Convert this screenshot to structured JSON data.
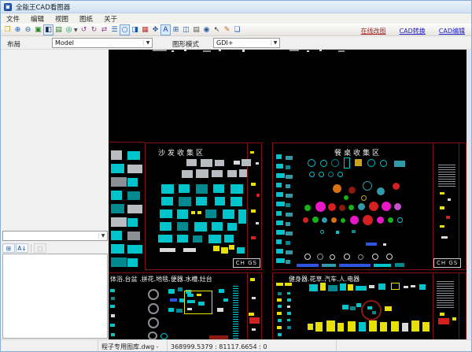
{
  "window": {
    "title": "全能王CAD看图器"
  },
  "menu": {
    "items": [
      {
        "label": "文件"
      },
      {
        "label": "编辑"
      },
      {
        "label": "视图"
      },
      {
        "label": "图纸"
      },
      {
        "label": "关于"
      }
    ]
  },
  "toolbar": {
    "icons": [
      {
        "name": "open-file-icon",
        "glyph": "❒",
        "color": "#caa31a"
      },
      {
        "name": "zoom-in-icon",
        "glyph": "⊕",
        "color": "#1a57a8"
      },
      {
        "name": "zoom-out-icon",
        "glyph": "⊖",
        "color": "#1a57a8"
      },
      {
        "name": "fit-view-icon",
        "glyph": "▣",
        "color": "#1f8a1f"
      },
      {
        "name": "background-toggle-icon",
        "glyph": "◧",
        "color": "#14264a",
        "pressed": true
      },
      {
        "name": "save-image-icon",
        "glyph": "▤",
        "color": "#1f8a1f"
      },
      {
        "name": "export-icon",
        "glyph": "◎",
        "color": "#1f8a6a",
        "dropdown": true
      },
      {
        "name": "rotate-left-icon",
        "glyph": "↺",
        "color": "#8a3c8a"
      },
      {
        "name": "rotate-right-icon",
        "glyph": "↻",
        "color": "#8a3c8a"
      },
      {
        "name": "swap-view-icon",
        "glyph": "⇄",
        "color": "#8a3c8a"
      },
      {
        "name": "layers-icon",
        "glyph": "☰",
        "color": "#1a57a8"
      },
      {
        "name": "circle-tool-icon",
        "glyph": "○",
        "color": "#1a57a8",
        "pressed": true
      },
      {
        "name": "image-view-icon",
        "glyph": "◨",
        "color": "#1a57a8"
      },
      {
        "name": "color-settings-icon",
        "glyph": "▦",
        "color": "#c03030"
      },
      {
        "name": "fullscreen-icon",
        "glyph": "✥",
        "color": "#1a57a8"
      },
      {
        "name": "text-tool-icon",
        "glyph": "A",
        "color": "#1333c0",
        "pressed": true
      },
      {
        "name": "measure-icon",
        "glyph": "⊞",
        "color": "#1a57a8"
      },
      {
        "name": "flip-icon",
        "glyph": "◫",
        "color": "#1a57a8"
      },
      {
        "name": "print-icon",
        "glyph": "▤",
        "color": "#5a5a5a"
      },
      {
        "name": "zoom-select-icon",
        "glyph": "◉",
        "color": "#1a57a8"
      },
      {
        "name": "select-cursor-icon",
        "glyph": "↖",
        "color": "#333333"
      },
      {
        "name": "annotate-icon",
        "glyph": "✎",
        "color": "#c06a1a"
      },
      {
        "name": "copy-icon",
        "glyph": "❏",
        "color": "#1a57a8"
      }
    ],
    "links": [
      {
        "label": "在线改图",
        "color": "#b02020"
      },
      {
        "label": "CAD转换",
        "color": "#1c1cc8"
      },
      {
        "label": "CAD编辑",
        "color": "#1c1cc8"
      }
    ]
  },
  "controls": {
    "layout_label": "布局",
    "layout_value": "Model",
    "mode_label": "图形模式",
    "mode_value": "GDI+"
  },
  "left_panel": {
    "combo_value": "",
    "tools": [
      {
        "name": "categorized-icon",
        "glyph": "⊞"
      },
      {
        "name": "sort-alphabetical-icon",
        "glyph": "A↓"
      },
      {
        "name": "property-pages-icon",
        "glyph": "▢",
        "disabled": true
      }
    ]
  },
  "cad": {
    "sections": [
      {
        "id": "sofa",
        "title": "沙发收集区",
        "corner_label": "CH GS"
      },
      {
        "id": "dining",
        "title": "餐桌收集区",
        "corner_label": "CH GS"
      },
      {
        "id": "bath",
        "title": "体浴.台盆 .拼花.地毯.便器.水槽.灶台"
      },
      {
        "id": "fitness",
        "title": "健身器.花草.汽车.人.电器"
      }
    ],
    "colors": {
      "background": "#000000",
      "section_border": "#7e1010",
      "cyan": "#00c4cc",
      "teal": "#00898f",
      "gray": "#b9bdc2",
      "yellow": "#e8e100",
      "magenta": "#e818c8",
      "red": "#d42020",
      "green": "#16b316",
      "orange": "#d8720e",
      "blue": "#2f55e0"
    }
  },
  "statusbar": {
    "filename": "程子专用图库.dwg -",
    "coordinates": "368999.5379 : 81117.6654 : 0"
  }
}
